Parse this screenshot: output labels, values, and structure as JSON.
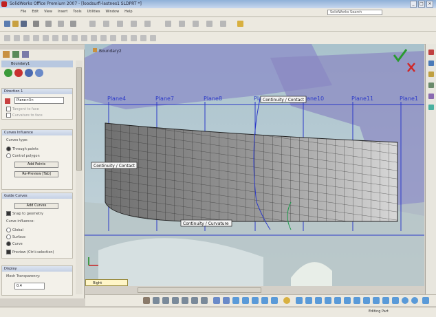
{
  "window": {
    "title": "SolidWorks Office Premium 2007 - [loodsurfi-lastnes1 SLDPRT *]",
    "help_search": "SolidWorks Search"
  },
  "menu": [
    "File",
    "Edit",
    "View",
    "Insert",
    "Tools",
    "Utilities",
    "Window",
    "Help"
  ],
  "property_manager": {
    "title": "Boundary1",
    "sections": {
      "direction1": {
        "header": "Direction 1",
        "curve_value": "Plane<3>",
        "options": [
          "Tangent to face",
          "Curvature to face"
        ]
      },
      "tangency": {
        "header": "Curves Influence",
        "subheader": "Curves type:",
        "options": [
          "Through points",
          "Control polygon"
        ],
        "buttons": [
          "Add Points",
          "Re-Preview [Tab]"
        ]
      },
      "direction2": {
        "header": "Guide Curves",
        "button": "Add Curves",
        "checkbox": "Snap to geometry",
        "subheader": "Curve influence:",
        "options": [
          "Global",
          "Surface",
          "Curve"
        ],
        "checkbox2": "Preview (Ctrl+selection)"
      },
      "display": {
        "header": "Display",
        "label": "Mesh Transparency:",
        "value": "0.4"
      }
    }
  },
  "viewport": {
    "feature_name": "Boundary2",
    "plane_labels": [
      "Plane4",
      "Plane7",
      "Plane8",
      "Plane9",
      "Plane10",
      "Plane11",
      "Plane1"
    ],
    "callouts": [
      "Continuity / Contact",
      "Continuity / Contact",
      "Continuity / Curvature"
    ],
    "view_selector": "Right"
  },
  "status": {
    "text": "Editing Part"
  },
  "colors": {
    "accent_ok": "#2a9a30",
    "accent_cancel": "#d02828",
    "plane_line": "#2a38c8"
  }
}
